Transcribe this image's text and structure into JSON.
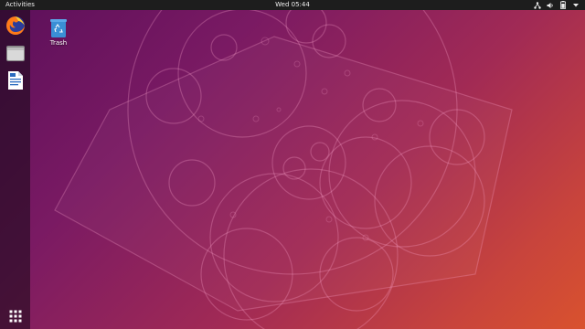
{
  "topbar": {
    "activities_label": "Activities",
    "clock": "Wed 05:44",
    "tray_icons": [
      "network-icon",
      "volume-icon",
      "battery-icon",
      "system-menu-arrow-icon"
    ]
  },
  "dock": {
    "items": [
      {
        "name": "Firefox Web Browser",
        "icon": "firefox-icon"
      },
      {
        "name": "Files",
        "icon": "files-icon"
      },
      {
        "name": "LibreOffice Writer",
        "icon": "writer-icon"
      }
    ],
    "apps_icon": "show-applications-icon"
  },
  "desktop": {
    "icons": [
      {
        "label": "Trash",
        "icon": "trash-icon"
      }
    ]
  },
  "colors": {
    "topbar": "#1d1d1d",
    "wallpaper_start": "#5b0f5a",
    "wallpaper_end": "#d9522e",
    "firefox_orange": "#ff7a18",
    "trash_blue": "#3a8fd6"
  }
}
